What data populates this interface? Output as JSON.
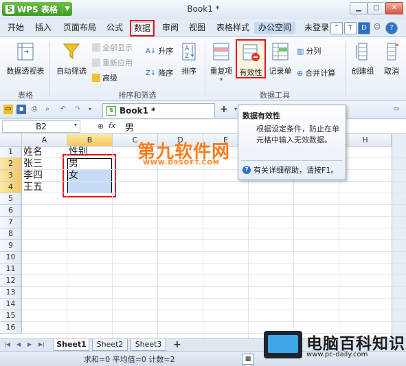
{
  "app": {
    "brand": "WPS 表格",
    "doc_title": "Book1 *"
  },
  "menu": {
    "tabs": [
      "开始",
      "插入",
      "页面布局",
      "公式",
      "数据",
      "审阅",
      "视图",
      "表格样式",
      "办公空间"
    ],
    "login": "未登录"
  },
  "ribbon": {
    "pivot": "数据透视表",
    "group_table": "表格",
    "autofilter": "自动筛选",
    "show_all": "全部显示",
    "reapply": "重新应用",
    "advanced": "高级",
    "sort_asc": "升序",
    "sort_desc": "降序",
    "sort": "排序",
    "group_sort_filter": "排序和筛选",
    "duplicates": "重复项",
    "validation": "有效性",
    "record": "记录单",
    "split": "分列",
    "merge_calc": "合并计算",
    "group_data_tools": "数据工具",
    "create_group": "创建组",
    "ungroup": "取消"
  },
  "doc_tab": "Book1 *",
  "formula_bar": {
    "name_box": "B2",
    "fx": "fx",
    "content": "男"
  },
  "grid": {
    "columns": [
      "A",
      "B",
      "C",
      "D",
      "E",
      "F",
      "G",
      "H"
    ],
    "rows": [
      "1",
      "2",
      "3",
      "4",
      "5",
      "6",
      "7",
      "8",
      "9",
      "10",
      "11",
      "12",
      "13",
      "14",
      "15",
      "16"
    ],
    "cells": {
      "A1": "姓名",
      "B1": "性别",
      "A2": "张三",
      "B2": "男",
      "A3": "李四",
      "B3": "女",
      "A4": "王五"
    }
  },
  "tooltip": {
    "title": "数据有效性",
    "body": "根据设定条件，防止在单元格中输入无效数据。",
    "help": "有关详细帮助，请按F1。"
  },
  "sheets": [
    "Sheet1",
    "Sheet2",
    "Sheet3"
  ],
  "status": "求和=0  平均值=0  计数=2",
  "watermarks": {
    "top": "第九软件网",
    "top_url": "WWW.D9SOFT.COM",
    "bottom": "电脑百科知识",
    "bottom_url": "www.pc-daily.com"
  },
  "colors": {
    "highlight_red": "#e0161c",
    "selection_blue": "#c6dcf4",
    "header_selected": "#f6c860"
  }
}
